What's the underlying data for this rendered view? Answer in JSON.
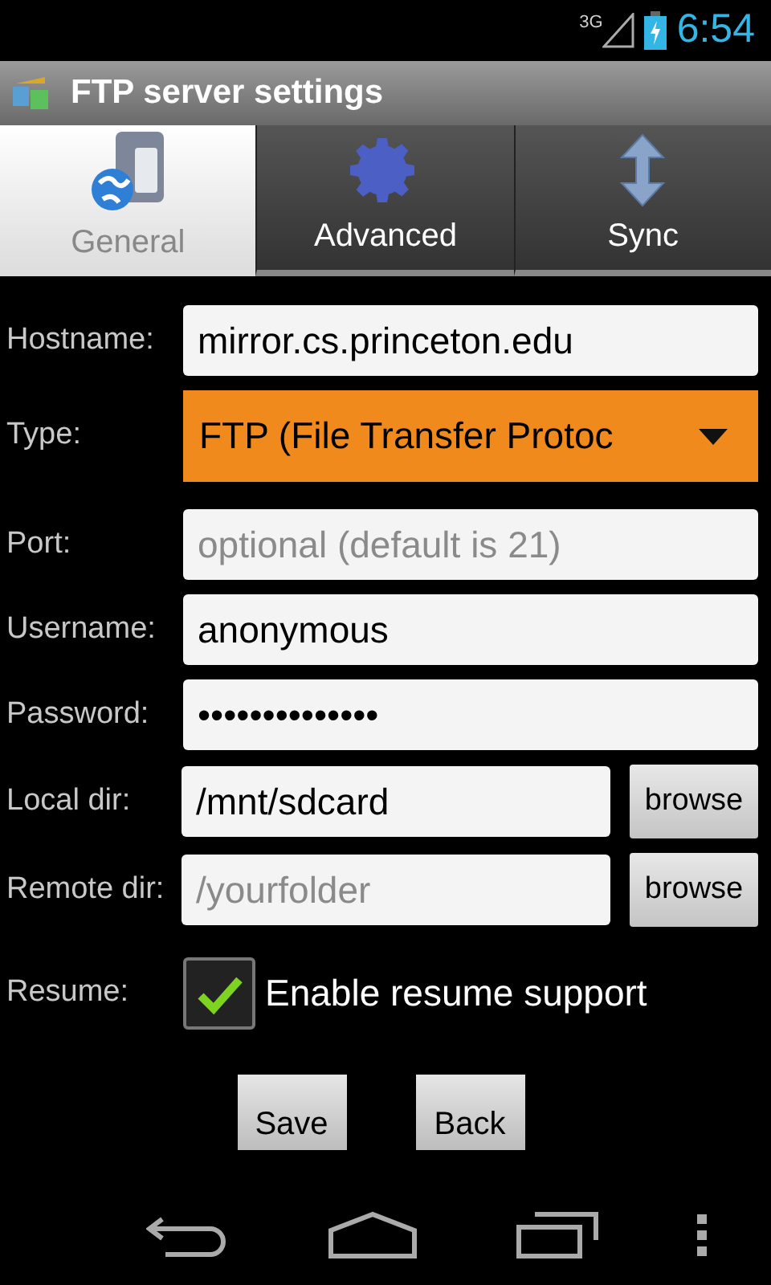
{
  "status_bar": {
    "network": "3G",
    "time": "6:54"
  },
  "window": {
    "title": "FTP server settings"
  },
  "tabs": [
    {
      "label": "General",
      "selected": true,
      "kind": "server"
    },
    {
      "label": "Advanced",
      "selected": false,
      "kind": "gear"
    },
    {
      "label": "Sync",
      "selected": false,
      "kind": "arrows"
    }
  ],
  "fields": [
    {
      "kind": "text",
      "label": "Hostname:",
      "value": "mirror.cs.princeton.edu"
    },
    {
      "kind": "select",
      "label": "Type:",
      "value": "FTP (File Transfer Protoc"
    },
    {
      "kind": "text",
      "label": "Port:",
      "placeholder": "optional (default is 21)"
    },
    {
      "kind": "text",
      "label": "Username:",
      "value": "anonymous"
    },
    {
      "kind": "text",
      "label": "Password:",
      "value": "••••••••••••••"
    },
    {
      "kind": "path",
      "label": "Local dir:",
      "value": "/mnt/sdcard",
      "button": "browse"
    },
    {
      "kind": "path",
      "label": "Remote dir:",
      "placeholder": "/yourfolder",
      "button": "browse"
    },
    {
      "kind": "checkbox",
      "label": "Resume:",
      "checked": true,
      "text": "Enable resume support"
    }
  ],
  "buttons": [
    "Save",
    "Back"
  ]
}
